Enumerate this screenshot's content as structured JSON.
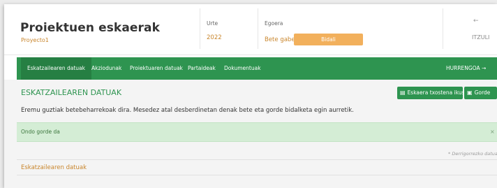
{
  "header": {
    "title": "Proiektuen eskaerak",
    "subtitle": "Proyecto1",
    "year_label": "Urte",
    "year_value": "2022",
    "status_label": "Egoera",
    "status_value": "Bete gabe",
    "send_button": "Bidali",
    "back_arrow": "←",
    "back_label": "ITZULI"
  },
  "nav": {
    "tabs": [
      {
        "label": "Eskatzailearen datuak",
        "active": true
      },
      {
        "label": "Akziodunak"
      },
      {
        "label": "Proiektuaren datuak"
      },
      {
        "label": "Partaideak"
      },
      {
        "label": "Dokumentuak"
      }
    ],
    "next_label": "HURRENGOA →"
  },
  "content": {
    "section_title": "ESKATZAILEAREN DATUAK",
    "view_request_button": "Eskaera txostena ikusi",
    "save_button": "Gorde",
    "instructions": "Eremu guztiak betebeharrekoak dira. Mesedez atal desberdinetan denak bete eta gorde bidalketa egin aurretik.",
    "alert_message": "Ondo gorde da",
    "alert_close": "×",
    "required_note": "* Derrigorrezko datuak",
    "subsection_title": "Eskatzailearen datuak"
  },
  "colors": {
    "accent_green": "#2e9450",
    "accent_orange": "#f2b05c",
    "link_orange": "#c9862d",
    "alert_bg": "#d4edd5"
  },
  "icons": {
    "view_request": "document-icon",
    "save": "floppy-icon",
    "back": "arrow-left-icon"
  }
}
